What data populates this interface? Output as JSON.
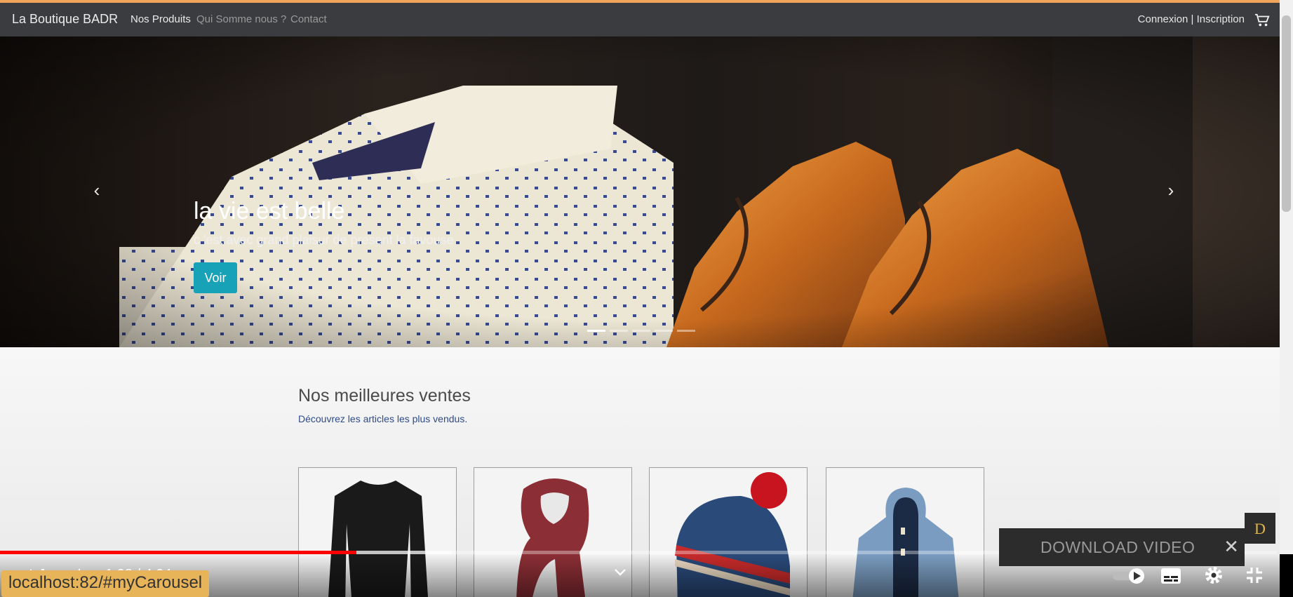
{
  "navbar": {
    "brand": "La Boutique BADR",
    "links": [
      "Nos Produits",
      "Qui Somme nous ?",
      "Contact"
    ],
    "auth": "Connexion | Inscription"
  },
  "hero": {
    "title": "la vie est belle",
    "subtitle": "c 'est avec grand plaisur de present la favouse",
    "button": "Voir",
    "prev": "‹",
    "next": "›",
    "slide_count": 5,
    "active_slide": 1
  },
  "section": {
    "title": "Nos meilleures ventes",
    "subtitle": "Découvrez les articles les plus vendus."
  },
  "products": [
    {
      "item": "black sweater-image"
    },
    {
      "item": "red scarf-image"
    },
    {
      "item": "bobble beanie-image"
    },
    {
      "item": "blue duffle coat-image"
    }
  ],
  "player": {
    "time": "1:08 / 4:04",
    "played_fraction": 0.279,
    "buffered_fraction": 0.354,
    "url": "localhost:82/#myCarousel",
    "download": "DOWNLOAD VIDEO",
    "close": "✕"
  }
}
